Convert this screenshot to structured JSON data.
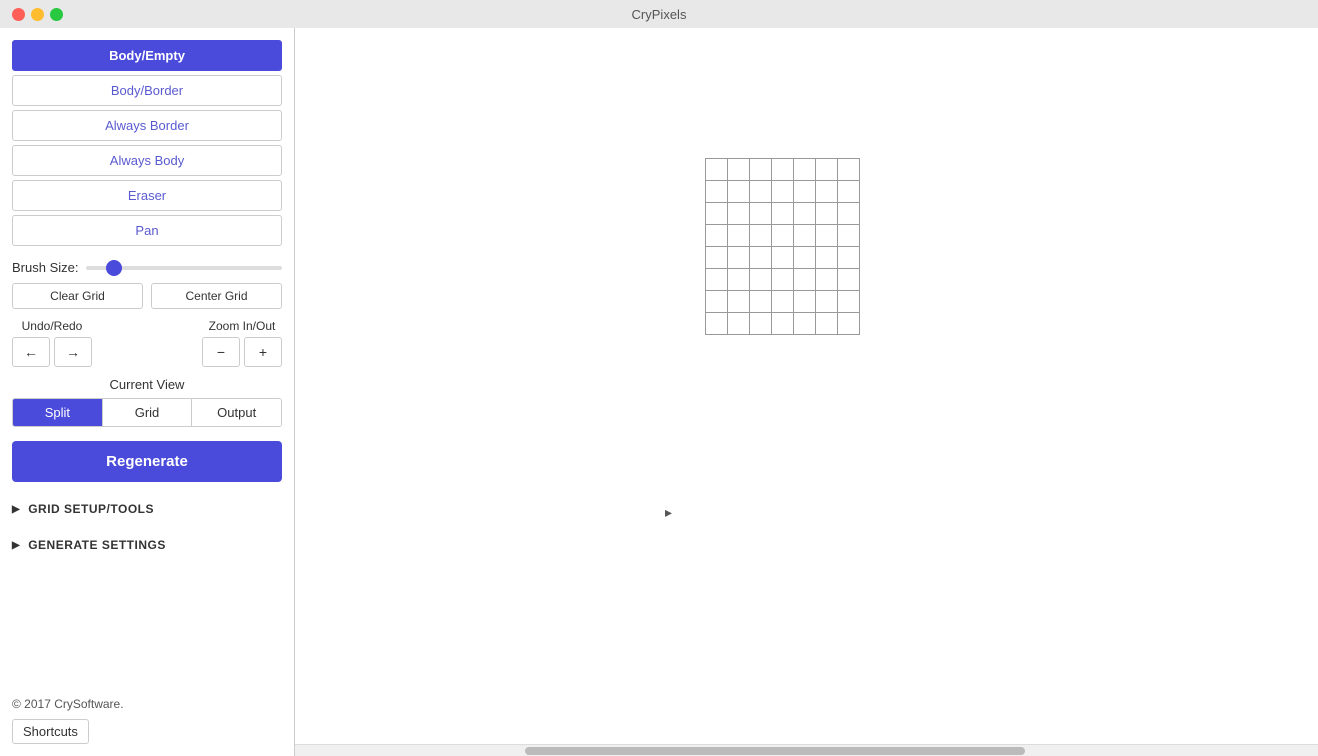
{
  "titleBar": {
    "title": "CryPixels"
  },
  "sidebar": {
    "tools": [
      {
        "id": "body-empty",
        "label": "Body/Empty",
        "active": true
      },
      {
        "id": "body-border",
        "label": "Body/Border",
        "active": false
      },
      {
        "id": "always-border",
        "label": "Always Border",
        "active": false
      },
      {
        "id": "always-body",
        "label": "Always Body",
        "active": false
      },
      {
        "id": "eraser",
        "label": "Eraser",
        "active": false
      },
      {
        "id": "pan",
        "label": "Pan",
        "active": false
      }
    ],
    "brushSize": {
      "label": "Brush Size:",
      "value": 20
    },
    "clearGrid": "Clear Grid",
    "centerGrid": "Center Grid",
    "undoRedo": {
      "label": "Undo/Redo",
      "undoIcon": "←",
      "redoIcon": "→"
    },
    "zoomInOut": {
      "label": "Zoom In/Out",
      "zoomOutIcon": "−",
      "zoomInIcon": "+"
    },
    "currentView": {
      "label": "Current View",
      "tabs": [
        {
          "id": "split",
          "label": "Split",
          "active": true
        },
        {
          "id": "grid",
          "label": "Grid",
          "active": false
        },
        {
          "id": "output",
          "label": "Output",
          "active": false
        }
      ]
    },
    "regenerate": "Regenerate",
    "gridSetupTools": "GRID SETUP/TOOLS",
    "generateSettings": "GENERATE SETTINGS",
    "copyright": "© 2017 CrySoftware.",
    "shortcuts": "Shortcuts"
  },
  "grid": {
    "rows": 8,
    "cols": 7
  }
}
